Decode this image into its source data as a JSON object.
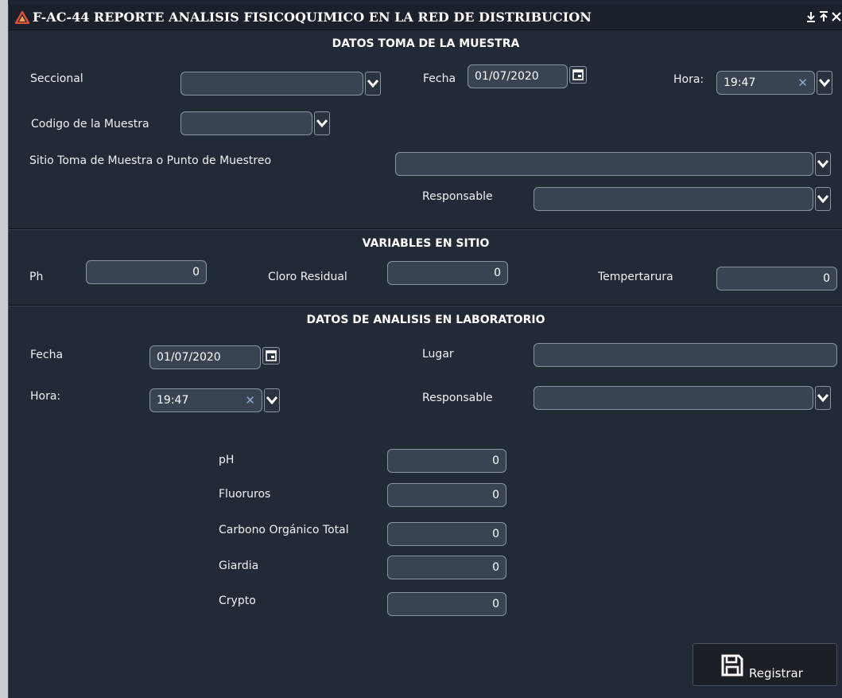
{
  "window": {
    "title": "F-AC-44 REPORTE ANALISIS FISICOQUIMICO EN LA RED DE DISTRIBUCION",
    "controls": [
      "download-icon",
      "pin-icon",
      "close-icon"
    ]
  },
  "sample_section": {
    "title": "DATOS TOMA DE LA MUESTRA",
    "seccional_label": "Seccional",
    "seccional_value": "",
    "fecha_label": "Fecha",
    "fecha_value": "01/07/2020",
    "hora_label": "Hora:",
    "hora_value": "19:47",
    "codigo_label": "Codigo de la Muestra",
    "codigo_value": "",
    "sitio_label": "Sitio Toma de Muestra o Punto de Muestreo",
    "sitio_value": "",
    "responsable_label": "Responsable",
    "responsable_value": ""
  },
  "site_section": {
    "title": "VARIABLES EN SITIO",
    "ph_label": "Ph",
    "ph_value": "0",
    "cloro_label": "Cloro Residual",
    "cloro_value": "0",
    "temp_label": "Tempertarura",
    "temp_value": "0"
  },
  "lab_section": {
    "title": "DATOS DE ANALISIS EN LABORATORIO",
    "fecha_label": "Fecha",
    "fecha_value": "01/07/2020",
    "lugar_label": "Lugar",
    "lugar_value": "",
    "hora_label": "Hora:",
    "hora_value": "19:47",
    "responsable_label": "Responsable",
    "responsable_value": "",
    "ph_label": "pH",
    "ph_value": "0",
    "fluoruros_label": "Fluoruros",
    "fluoruros_value": "0",
    "cot_label": "Carbono Orgánico Total",
    "cot_value": "0",
    "giardia_label": "Giardia",
    "giardia_value": "0",
    "crypto_label": "Crypto",
    "crypto_value": "0"
  },
  "actions": {
    "register_label": "Registrar",
    "register_icon": "floppy-disk-icon"
  },
  "colors": {
    "background": "#222a36",
    "field": "#394352",
    "field_border": "#8b94a2",
    "accent_logo": "#e0503a",
    "clear_icon": "#8fa6d8"
  }
}
